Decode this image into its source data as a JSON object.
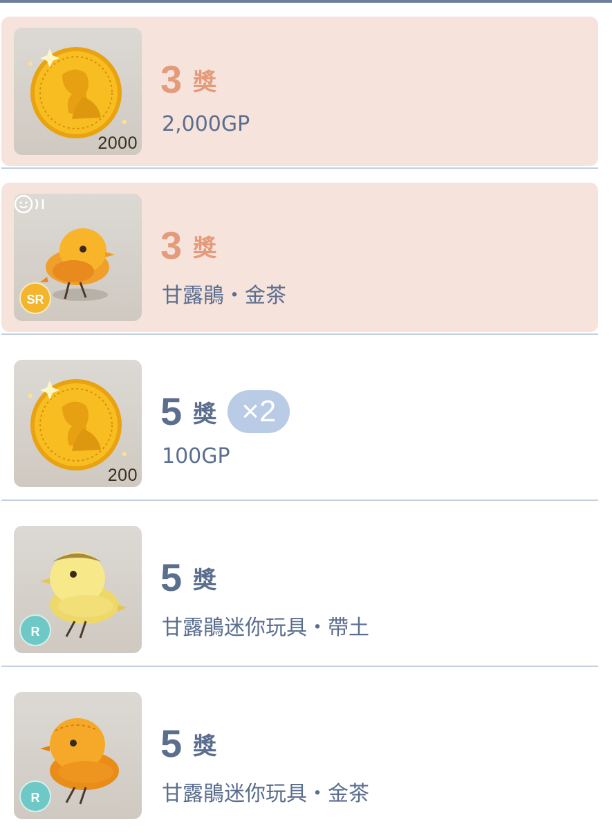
{
  "prizes": [
    {
      "rank": "3",
      "unit": "獎",
      "name": "2,000GP",
      "amount": "2000",
      "rarity": "",
      "multiplier": "",
      "highlighted": true,
      "icon": "gold-coin-icon"
    },
    {
      "rank": "3",
      "unit": "獎",
      "name": "甘露鵑・金茶",
      "amount": "",
      "rarity": "SR",
      "multiplier": "",
      "highlighted": true,
      "icon": "orange-chick-icon",
      "has_sound": true
    },
    {
      "rank": "5",
      "unit": "獎",
      "name": "100GP",
      "amount": "200",
      "rarity": "",
      "multiplier": "×2",
      "highlighted": false,
      "icon": "gold-coin-icon"
    },
    {
      "rank": "5",
      "unit": "獎",
      "name": "甘露鵑迷你玩具・帶土",
      "amount": "",
      "rarity": "R",
      "multiplier": "",
      "highlighted": false,
      "icon": "yellow-chick-toy-icon"
    },
    {
      "rank": "5",
      "unit": "獎",
      "name": "甘露鵑迷你玩具・金茶",
      "amount": "",
      "rarity": "R",
      "multiplier": "",
      "highlighted": false,
      "icon": "orange-chick-toy-icon"
    }
  ],
  "colors": {
    "highlight_bg": "#f6e3dc",
    "highlight_text": "#e39b7c",
    "plain_text": "#5b6e8e",
    "multiplier_bg": "#b9cbe5",
    "sr_badge": "#f2b52c",
    "r_badge": "#6ec9c6"
  }
}
